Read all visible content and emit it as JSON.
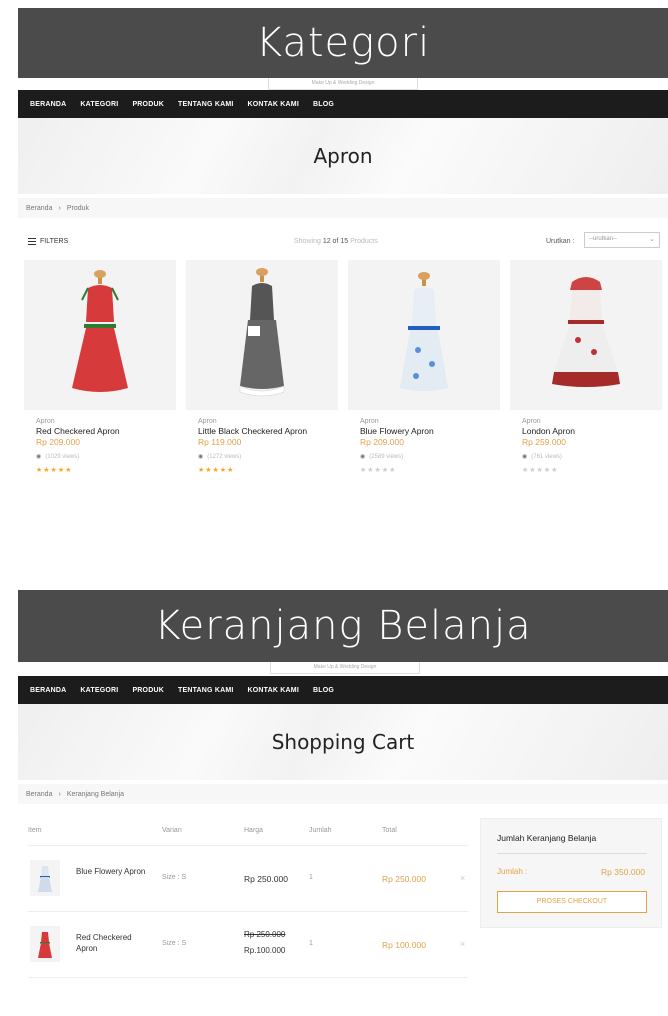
{
  "section1": {
    "banner": "Kategori"
  },
  "section2": {
    "banner": "Keranjang Belanja"
  },
  "logo_text": "Make Up & Wedding Design",
  "nav": [
    "BERANDA",
    "KATEGORI",
    "PRODUK",
    "TENTANG KAMI",
    "KONTAK KAMI",
    "BLOG"
  ],
  "category": {
    "hero_title": "Apron",
    "breadcrumb": [
      "Beranda",
      "Produk"
    ],
    "filters_label": "FILTERS",
    "showing_prefix": "Showing",
    "showing_count": "12 of 15",
    "showing_suffix": "Products",
    "sort_label": "Urutkan :",
    "sort_value": "--urutkan--",
    "products": [
      {
        "category": "Apron",
        "name": "Red Checkered Apron",
        "price": "Rp 209.000",
        "views": "(1029 views)",
        "rating": 5
      },
      {
        "category": "Apron",
        "name": "Little Black Checkered Apron",
        "price": "Rp 119.000",
        "views": "(1272 views)",
        "rating": 5
      },
      {
        "category": "Apron",
        "name": "Blue Flowery Apron",
        "price": "Rp 209.000",
        "views": "(2589 views)",
        "rating": 0
      },
      {
        "category": "Apron",
        "name": "London Apron",
        "price": "Rp 259.000",
        "views": "(761 views)",
        "rating": 0
      }
    ],
    "colors": {
      "accent": "#e2a24a",
      "star_on": "#f5a623",
      "star_off": "#cccccc"
    }
  },
  "cart": {
    "hero_title": "Shopping Cart",
    "breadcrumb": [
      "Beranda",
      "Keranjang Belanja"
    ],
    "headers": {
      "item": "Item",
      "variant": "Varian",
      "price": "Harga",
      "qty": "Jumlah",
      "total": "Total"
    },
    "rows": [
      {
        "name": "Blue Flowery Apron",
        "variant": "Size : S",
        "price": "Rp 250.000",
        "old_price": "",
        "qty": "1",
        "total": "Rp 250.000"
      },
      {
        "name": "Red Checkered Apron",
        "variant": "Size : S",
        "price": "Rp.100.000",
        "old_price": "Rp 250.000",
        "qty": "1",
        "total": "Rp 100.000"
      }
    ],
    "summary": {
      "title": "Jumlah Keranjang Belanja",
      "label": "Jumlah :",
      "value": "Rp 350.000",
      "checkout": "PROSES CHECKOUT"
    }
  }
}
